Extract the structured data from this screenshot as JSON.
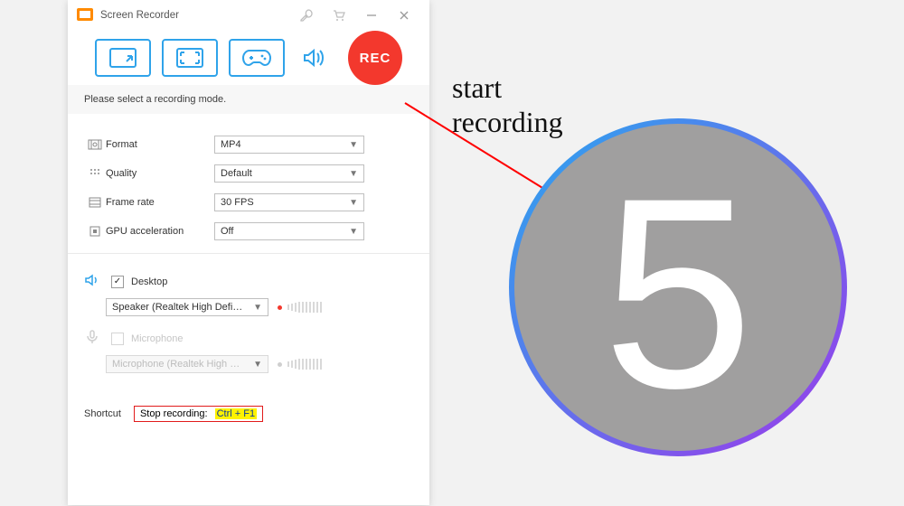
{
  "window": {
    "title": "Screen Recorder"
  },
  "modes": {
    "hint": "Please select a recording mode.",
    "rec_label": "REC"
  },
  "settings": {
    "format": {
      "label": "Format",
      "value": "MP4"
    },
    "quality": {
      "label": "Quality",
      "value": "Default"
    },
    "frame_rate": {
      "label": "Frame rate",
      "value": "30 FPS"
    },
    "gpu": {
      "label": "GPU acceleration",
      "value": "Off"
    }
  },
  "audio": {
    "desktop": {
      "label": "Desktop",
      "device": "Speaker (Realtek High Defi…",
      "checked": true
    },
    "mic": {
      "label": "Microphone",
      "device": "Microphone (Realtek High …",
      "checked": false
    }
  },
  "shortcut": {
    "label": "Shortcut",
    "action": "Stop recording:",
    "keys": "Ctrl + F1"
  },
  "annotation": {
    "line1": "start",
    "line2": "recording"
  },
  "countdown": {
    "value": "5"
  }
}
